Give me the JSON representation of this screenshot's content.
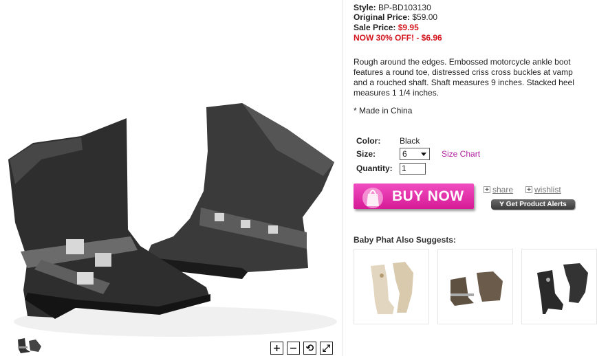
{
  "product": {
    "style_label": "Style:",
    "style_value": "BP-BD103130",
    "original_label": "Original Price:",
    "original_value": "$59.00",
    "sale_label": "Sale Price:",
    "sale_value": "$9.95",
    "now_off": "NOW 30% OFF! - $6.96",
    "description": "Rough around the edges. Embossed motorcycle ankle boot features a round toe, distressed criss cross buckles at vamp and a rouched shaft. Shaft measures 9 inches. Stacked heel measures 1 1/4 inches.",
    "made_in": "* Made in China"
  },
  "options": {
    "color_label": "Color:",
    "color_value": "Black",
    "size_label": "Size:",
    "size_value": "6",
    "size_chart": "Size Chart",
    "quantity_label": "Quantity:",
    "quantity_value": "1"
  },
  "actions": {
    "buy_now": "BUY NOW",
    "share": "share",
    "wishlist": "wishlist",
    "product_alerts": "Get Product Alerts"
  },
  "suggestions": {
    "title": "Baby Phat Also Suggests:"
  },
  "viewer": {
    "zoom_in": "+",
    "zoom_out": "−",
    "rotate": "⟲",
    "fullscreen": "⤢"
  },
  "colors": {
    "sale_red": "#d3141c",
    "link_magenta": "#b1229f",
    "buy_pink": "#e22fa8"
  }
}
